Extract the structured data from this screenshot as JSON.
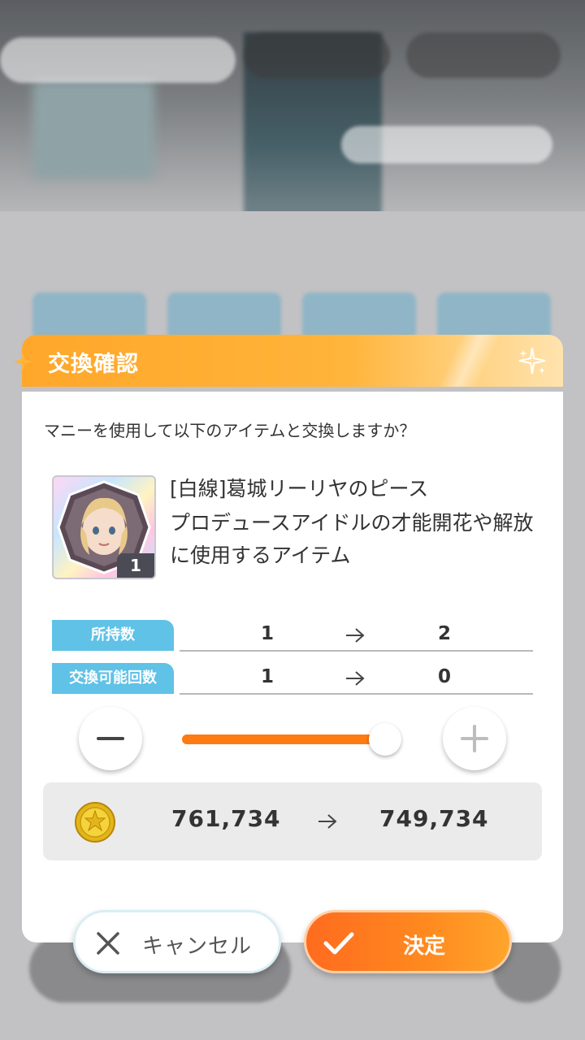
{
  "dialog": {
    "title": "交換確認",
    "prompt": "マニーを使用して以下のアイテムと交換しますか？"
  },
  "item": {
    "name": "[白線]葛城リーリヤのピース",
    "description": "プロデュースアイドルの才能開花や解放に使用するアイテム",
    "count": "1",
    "icon": "idol-piece-icon"
  },
  "stats": [
    {
      "label": "所持数",
      "from": "1",
      "to": "2"
    },
    {
      "label": "交換可能回数",
      "from": "1",
      "to": "0"
    }
  ],
  "slider": {
    "value": 1,
    "min": 0,
    "max": 1,
    "fill_fraction": 1.0
  },
  "currency": {
    "icon": "manny-coin-icon",
    "from": "761,734",
    "to": "749,734"
  },
  "buttons": {
    "cancel_label": "キャンセル",
    "confirm_label": "決定"
  },
  "colors": {
    "header": "#ffa72a",
    "stat_label": "#5fc2e6",
    "slider_fill": "#fe7a12",
    "confirm": "#ff6b1f"
  }
}
